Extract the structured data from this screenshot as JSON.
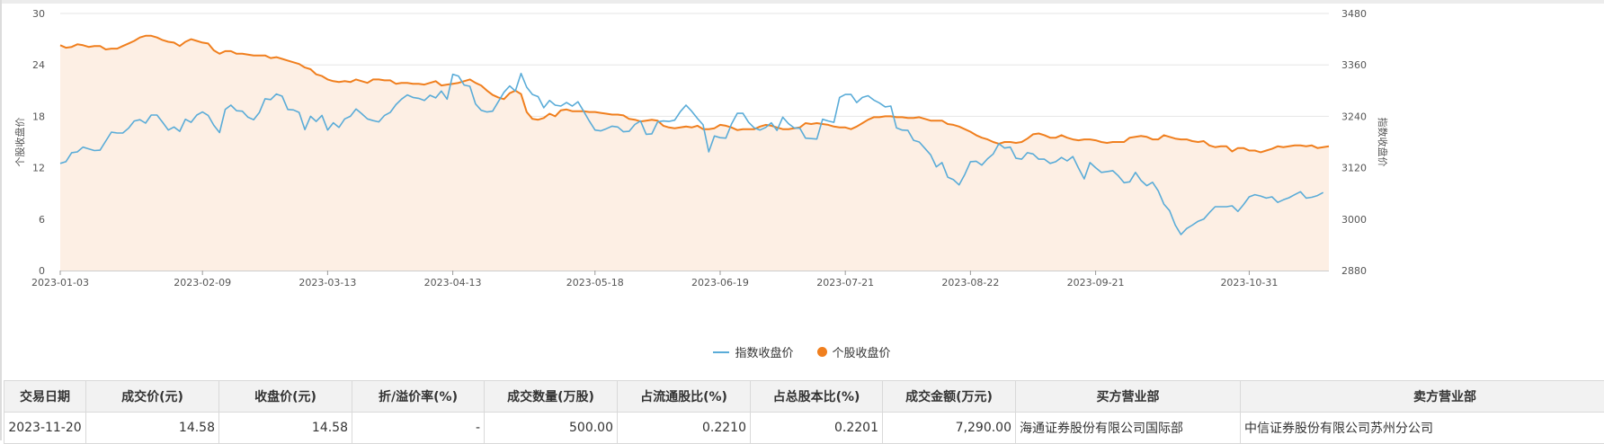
{
  "chart_data": {
    "type": "line",
    "x_ticks": [
      "2023-01-03",
      "2023-02-09",
      "2023-03-13",
      "2023-04-13",
      "2023-05-18",
      "2023-06-19",
      "2023-07-21",
      "2023-08-22",
      "2023-09-21",
      "2023-10-31"
    ],
    "x_tick_index": [
      0,
      25,
      47,
      69,
      94,
      116,
      138,
      160,
      182,
      209
    ],
    "y_left": {
      "label": "个股收盘价",
      "ticks": [
        0,
        6,
        12,
        18,
        24,
        30
      ],
      "lim": [
        0,
        30
      ]
    },
    "y_right": {
      "label": "指数收盘价",
      "ticks": [
        2880,
        3000,
        3120,
        3240,
        3360,
        3480
      ],
      "lim": [
        2880,
        3480
      ]
    },
    "grid": true,
    "legend_position": "bottom",
    "series": [
      {
        "name": "指数收盘价",
        "axis": "right",
        "color": "#5aacd8",
        "style": "line",
        "values": [
          3130,
          3134,
          3155,
          3157,
          3168,
          3164,
          3160,
          3161,
          3182,
          3203,
          3201,
          3201,
          3212,
          3229,
          3232,
          3224,
          3243,
          3243,
          3226,
          3208,
          3215,
          3205,
          3233,
          3226,
          3243,
          3250,
          3242,
          3219,
          3202,
          3256,
          3266,
          3253,
          3252,
          3238,
          3232,
          3249,
          3281,
          3279,
          3292,
          3287,
          3256,
          3255,
          3249,
          3209,
          3240,
          3228,
          3242,
          3208,
          3225,
          3214,
          3234,
          3240,
          3257,
          3246,
          3234,
          3230,
          3227,
          3242,
          3249,
          3267,
          3280,
          3290,
          3284,
          3282,
          3277,
          3289,
          3283,
          3299,
          3280,
          3338,
          3334,
          3313,
          3310,
          3269,
          3254,
          3250,
          3252,
          3274,
          3296,
          3311,
          3299,
          3340,
          3308,
          3291,
          3286,
          3260,
          3277,
          3266,
          3264,
          3272,
          3264,
          3274,
          3252,
          3229,
          3208,
          3206,
          3211,
          3217,
          3215,
          3204,
          3205,
          3221,
          3229,
          3198,
          3199,
          3227,
          3229,
          3228,
          3231,
          3251,
          3266,
          3252,
          3235,
          3220,
          3157,
          3194,
          3190,
          3189,
          3222,
          3247,
          3247,
          3226,
          3213,
          3208,
          3214,
          3225,
          3207,
          3238,
          3223,
          3213,
          3212,
          3189,
          3188,
          3187,
          3233,
          3229,
          3226,
          3284,
          3291,
          3291,
          3272,
          3284,
          3288,
          3278,
          3271,
          3262,
          3264,
          3213,
          3208,
          3207,
          3184,
          3180,
          3165,
          3150,
          3122,
          3132,
          3098,
          3092,
          3080,
          3104,
          3134,
          3135,
          3126,
          3141,
          3152,
          3176,
          3166,
          3168,
          3142,
          3140,
          3155,
          3152,
          3140,
          3140,
          3130,
          3134,
          3144,
          3136,
          3146,
          3119,
          3094,
          3132,
          3120,
          3109,
          3111,
          3113,
          3101,
          3085,
          3087,
          3109,
          3090,
          3078,
          3086,
          3066,
          3035,
          3020,
          2986,
          2964,
          2978,
          2986,
          2995,
          3000,
          3015,
          3029,
          3029,
          3029,
          3031,
          3018,
          3034,
          3052,
          3057,
          3054,
          3049,
          3052,
          3039,
          3045,
          3050,
          3057,
          3064,
          3049,
          3051,
          3055,
          3062
        ]
      },
      {
        "name": "个股收盘价",
        "axis": "left",
        "color": "#f07f1e",
        "style": "area",
        "values": [
          26.3,
          26.0,
          26.1,
          26.4,
          26.3,
          26.1,
          26.2,
          26.2,
          25.8,
          25.9,
          25.9,
          26.2,
          26.5,
          26.8,
          27.2,
          27.4,
          27.4,
          27.2,
          26.9,
          26.7,
          26.6,
          26.2,
          26.7,
          27.0,
          26.8,
          26.6,
          26.5,
          25.7,
          25.3,
          25.6,
          25.6,
          25.3,
          25.3,
          25.2,
          25.1,
          25.1,
          25.1,
          24.8,
          24.9,
          24.7,
          24.5,
          24.3,
          24.1,
          23.7,
          23.5,
          22.9,
          22.7,
          22.3,
          22.1,
          22.0,
          22.1,
          22.0,
          22.3,
          22.1,
          21.9,
          22.3,
          22.3,
          22.2,
          22.2,
          21.8,
          21.9,
          21.9,
          21.8,
          21.8,
          21.7,
          21.9,
          22.1,
          21.6,
          21.7,
          21.8,
          21.9,
          22.1,
          22.3,
          21.9,
          21.6,
          21.0,
          20.5,
          20.2,
          20.0,
          20.7,
          21.0,
          20.6,
          18.5,
          17.7,
          17.6,
          17.8,
          18.3,
          18.0,
          18.7,
          18.8,
          18.6,
          18.6,
          18.6,
          18.5,
          18.5,
          18.4,
          18.3,
          18.2,
          18.2,
          18.1,
          17.7,
          17.6,
          17.4,
          17.5,
          17.6,
          17.5,
          16.9,
          16.7,
          16.6,
          16.7,
          16.8,
          16.7,
          16.9,
          16.5,
          16.5,
          16.6,
          17.0,
          16.9,
          16.7,
          16.4,
          16.5,
          16.5,
          16.5,
          16.8,
          17.0,
          16.9,
          16.7,
          16.5,
          16.5,
          16.6,
          16.7,
          17.2,
          17.1,
          17.2,
          17.1,
          17.0,
          16.8,
          16.7,
          16.7,
          16.5,
          16.8,
          17.2,
          17.6,
          17.9,
          17.9,
          18.0,
          18.0,
          17.9,
          17.9,
          17.8,
          17.8,
          17.9,
          17.7,
          17.5,
          17.5,
          17.5,
          17.1,
          17.0,
          16.8,
          16.5,
          16.2,
          15.8,
          15.5,
          15.3,
          15.0,
          14.8,
          15.0,
          15.0,
          14.9,
          15.0,
          15.4,
          15.9,
          16.0,
          15.8,
          15.5,
          15.5,
          15.8,
          15.5,
          15.3,
          15.2,
          15.3,
          15.3,
          15.2,
          15.0,
          14.9,
          15.0,
          15.0,
          15.0,
          15.5,
          15.6,
          15.7,
          15.6,
          15.3,
          15.3,
          15.8,
          15.6,
          15.4,
          15.3,
          15.3,
          15.1,
          15.0,
          15.1,
          14.6,
          14.4,
          14.5,
          14.5,
          13.9,
          14.3,
          14.3,
          14.0,
          14.0,
          13.8,
          14.0,
          14.2,
          14.5,
          14.4,
          14.5,
          14.6,
          14.6,
          14.5,
          14.6,
          14.3,
          14.4,
          14.5
        ]
      }
    ]
  },
  "table": {
    "headers": [
      "交易日期",
      "成交价(元)",
      "收盘价(元)",
      "折/溢价率(%)",
      "成交数量(万股)",
      "占流通股比(%)",
      "占总股本比(%)",
      "成交金额(万元)",
      "买方营业部",
      "卖方营业部"
    ],
    "row": [
      "2023-11-20",
      "14.58",
      "14.58",
      "-",
      "500.00",
      "0.2210",
      "0.2201",
      "7,290.00",
      "海通证券股份有限公司国际部",
      "中信证券股份有限公司苏州分公司"
    ]
  }
}
